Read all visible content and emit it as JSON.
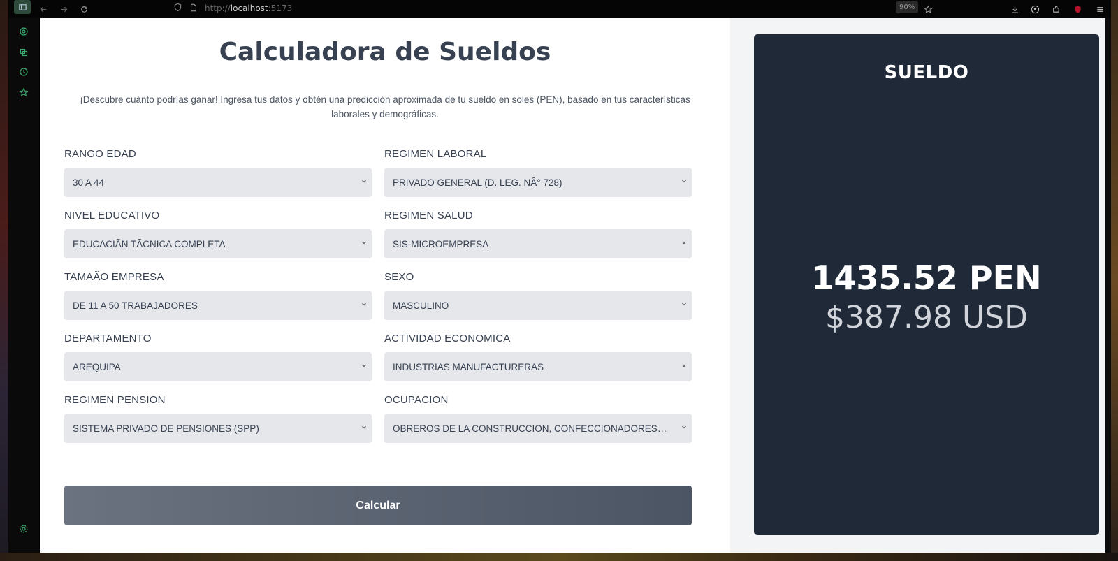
{
  "browser": {
    "url_proto": "http://",
    "url_host": "localhost",
    "url_port": ":5173",
    "zoom": "90%"
  },
  "page": {
    "title": "Calculadora de Sueldos",
    "description": "¡Descubre cuánto podrías ganar! Ingresa tus datos y obtén una predicción aproximada de tu sueldo en soles (PEN), basado en tus características laborales y demográficas."
  },
  "fields": {
    "rango_edad": {
      "label": "RANGO EDAD",
      "value": "30 A 44"
    },
    "regimen_laboral": {
      "label": "REGIMEN LABORAL",
      "value": "PRIVADO GENERAL (D. LEG. NÂ° 728)"
    },
    "nivel_educativo": {
      "label": "NIVEL EDUCATIVO",
      "value": "EDUCACIÃN TÃCNICA COMPLETA"
    },
    "regimen_salud": {
      "label": "REGIMEN SALUD",
      "value": "SIS-MICROEMPRESA"
    },
    "tamano_empresa": {
      "label": "TAMAÃO EMPRESA",
      "value": "DE 11 A 50 TRABAJADORES"
    },
    "sexo": {
      "label": "SEXO",
      "value": "MASCULINO"
    },
    "departamento": {
      "label": "DEPARTAMENTO",
      "value": "AREQUIPA"
    },
    "actividad_economica": {
      "label": "ACTIVIDAD ECONOMICA",
      "value": "INDUSTRIAS MANUFACTURERAS"
    },
    "regimen_pension": {
      "label": "REGIMEN PENSION",
      "value": "SISTEMA PRIVADO DE PENSIONES (SPP)"
    },
    "ocupacion": {
      "label": "OCUPACION",
      "value": "OBREROS DE LA CONSTRUCCION, CONFECCIONADORES DE PRODUCTOS"
    }
  },
  "calc_button": "Calcular",
  "result": {
    "title": "SUELDO",
    "pen": "1435.52 PEN",
    "usd": "$387.98 USD"
  },
  "colors": {
    "card_bg": "#1f2937",
    "select_bg": "#e5e7eb",
    "text_dark": "#374151",
    "sidebar_accent": "#3aa86a"
  },
  "icons": [
    "sidebar-toggle-icon",
    "back-icon",
    "forward-icon",
    "reload-icon",
    "shield-icon",
    "page-icon",
    "star-icon",
    "download-icon",
    "account-icon",
    "extensions-icon",
    "ublock-icon",
    "menu-icon",
    "gear-icon",
    "history-icon",
    "bookmark-icon",
    "chevron-down-icon"
  ]
}
